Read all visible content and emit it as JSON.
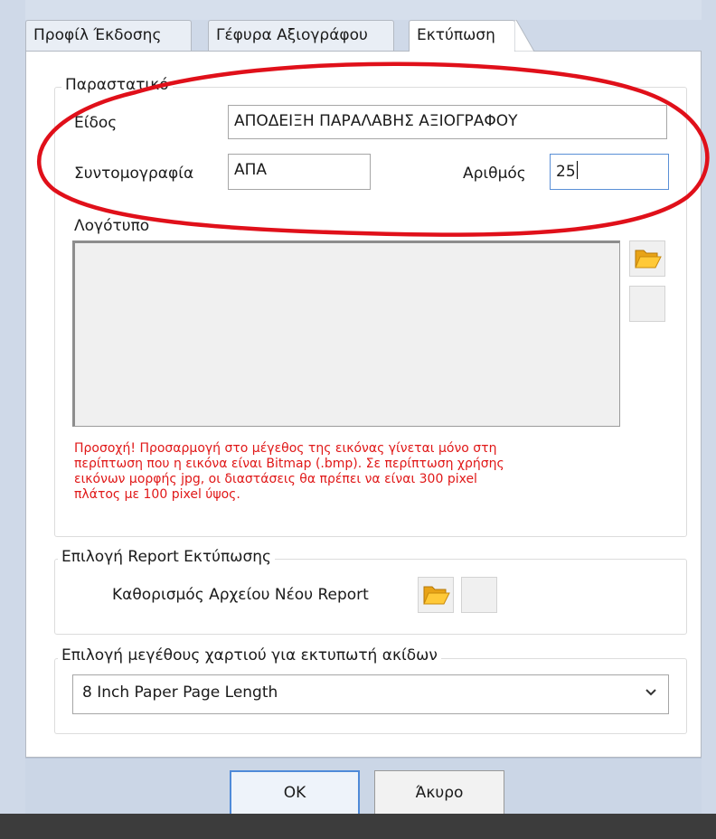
{
  "tabs": [
    {
      "label": "Προφίλ Έκδοσης"
    },
    {
      "label": "Γέφυρα Αξιογράφου"
    },
    {
      "label": "Εκτύπωση"
    }
  ],
  "document_group": {
    "title": "Παραστατικό",
    "type_label": "Είδος",
    "type_value": "ΑΠΟΔΕΙΞΗ ΠΑΡΑΛΑΒΗΣ ΑΞΙΟΓΡΑΦΟΥ",
    "abbrev_label": "Συντομογραφία",
    "abbrev_value": "ΑΠΑ",
    "number_label": "Αριθμός",
    "number_value": "25",
    "logo_label": "Λογότυπο",
    "warning_lines": [
      "Προσοχή! Προσαρμογή στο μέγεθος της εικόνας γίνεται μόνο στη",
      "περίπτωση που η εικόνα είναι Bitmap (.bmp). Σε περίπτωση χρήσης",
      "εικόνων μορφής jpg, οι διαστάσεις θα πρέπει να είναι 300 pixel",
      "πλάτος με 100 pixel ύψος."
    ]
  },
  "report_group": {
    "title": "Επιλογή Report Εκτύπωσης",
    "define_label": "Καθορισμός Αρχείου Νέου Report"
  },
  "paper_group": {
    "title": "Επιλογή μεγέθους χαρτιού για εκτυπωτή ακίδων",
    "selected": "8 Inch Paper Page Length"
  },
  "buttons": {
    "ok": "OK",
    "cancel": "Άκυρο"
  },
  "icons": {
    "folder": "folder-icon",
    "clear": "clear-icon",
    "dropdown": "chevron-down-icon"
  },
  "colors": {
    "warning": "#e01818",
    "annotation": "#e0101a",
    "focus": "#5a8fd6"
  }
}
